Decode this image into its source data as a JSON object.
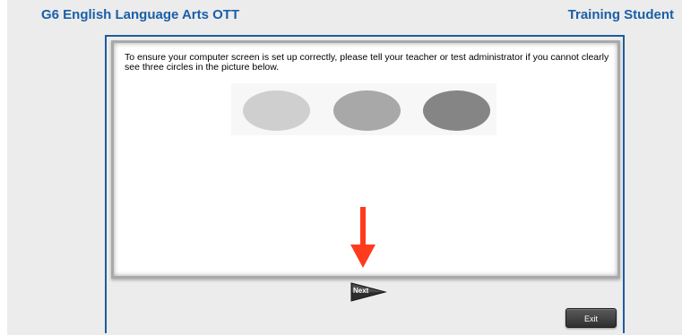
{
  "header": {
    "test_title": "G6 English Language Arts OTT",
    "student_name": "Training Student"
  },
  "screen_check": {
    "instructions": "To ensure your computer screen is set up correctly, please tell your teacher or test administrator if you cannot clearly see three circles in the picture below.",
    "circle_colors": [
      "#cfcfcf",
      "#a8a8a8",
      "#858585"
    ]
  },
  "annotation": {
    "arrow_icon": "down-arrow-icon",
    "arrow_color": "#ff3b1f"
  },
  "navigation": {
    "next_label": "Next",
    "exit_label": "Exit"
  },
  "colors": {
    "header_text": "#1a5fa8",
    "frame_border": "#1d5d9c",
    "background": "#ececec"
  }
}
